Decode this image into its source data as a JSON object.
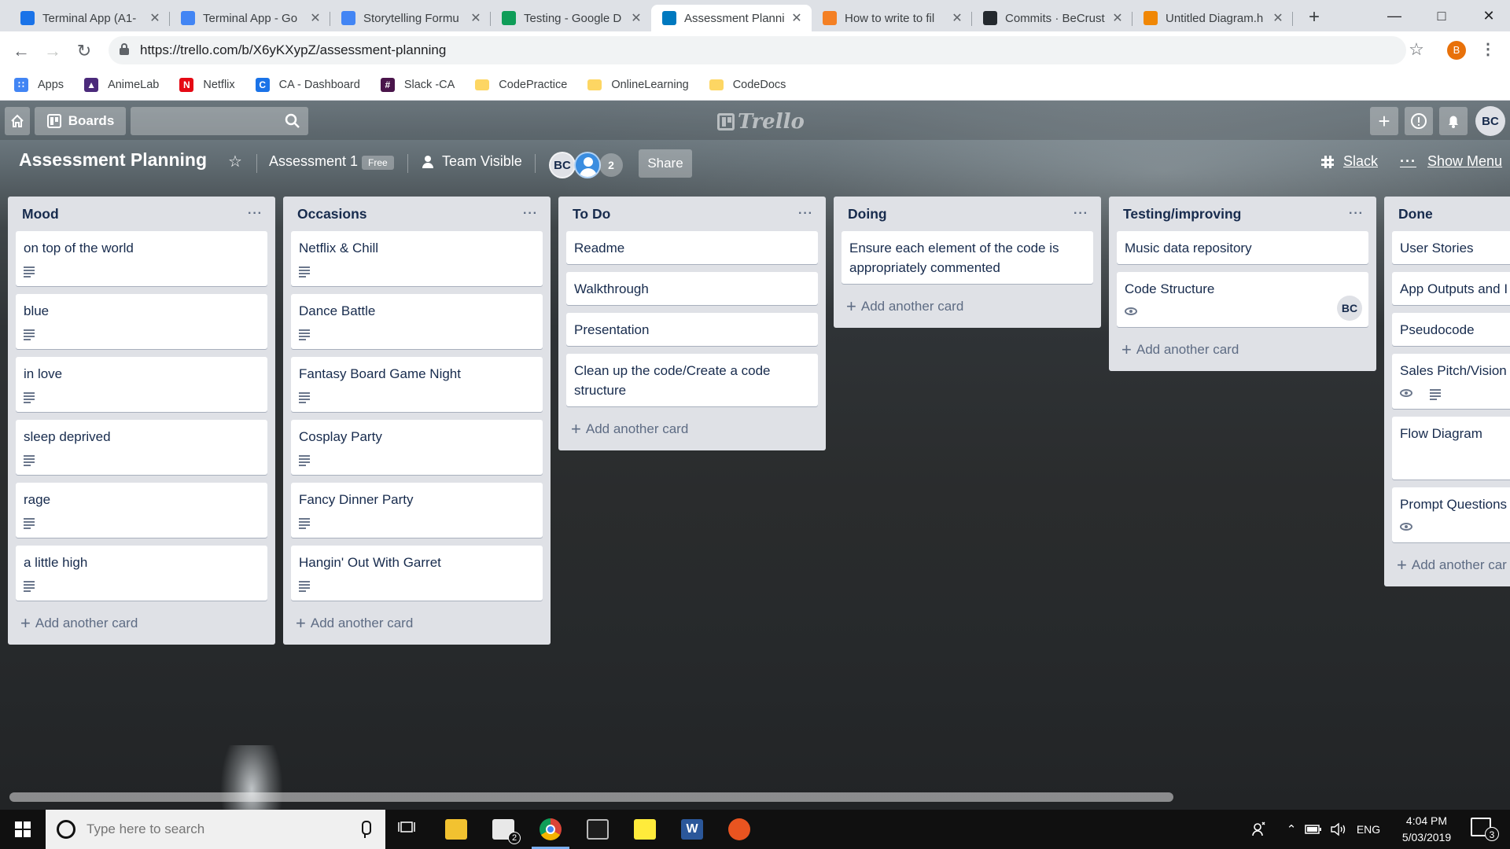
{
  "browser": {
    "tabs": [
      {
        "label": "Terminal App (A1-",
        "favicon": "ca-favicon",
        "color": "#1a73e8"
      },
      {
        "label": "Terminal App - Go",
        "favicon": "google-docs-favicon",
        "color": "#4285f4"
      },
      {
        "label": "Storytelling Formu",
        "favicon": "google-docs-favicon",
        "color": "#4285f4"
      },
      {
        "label": "Testing - Google D",
        "favicon": "google-drive-favicon",
        "color": "#0f9d58"
      },
      {
        "label": "Assessment Planni",
        "favicon": "trello-favicon",
        "color": "#0079bf"
      },
      {
        "label": "How to write to fil",
        "favicon": "stack-favicon",
        "color": "#f48024"
      },
      {
        "label": "Commits · BeCrust",
        "favicon": "github-favicon",
        "color": "#24292e"
      },
      {
        "label": "Untitled Diagram.h",
        "favicon": "drawio-favicon",
        "color": "#f08705"
      }
    ],
    "active_tab": 4,
    "url": "https://trello.com/b/X6yKXypZ/assessment-planning",
    "profile_initial": "B",
    "bookmarks": [
      {
        "label": "Apps",
        "icon": "apps-grid-icon"
      },
      {
        "label": "AnimeLab",
        "icon": "animelab-icon"
      },
      {
        "label": "Netflix",
        "icon": "netflix-icon"
      },
      {
        "label": "CA - Dashboard",
        "icon": "ca-icon"
      },
      {
        "label": "Slack -CA",
        "icon": "slack-icon"
      },
      {
        "label": "CodePractice",
        "icon": "folder-icon"
      },
      {
        "label": "OnlineLearning",
        "icon": "folder-icon"
      },
      {
        "label": "CodeDocs",
        "icon": "folder-icon"
      }
    ]
  },
  "trello": {
    "header": {
      "boards_label": "Boards",
      "search_value": "",
      "logo_text": "Trello",
      "user_initials": "BC"
    },
    "board": {
      "title": "Assessment Planning",
      "team_name": "Assessment 1",
      "team_badge": "Free",
      "visibility": "Team Visible",
      "member_initials": "BC",
      "member_count": "2",
      "share_label": "Share",
      "slack_label": "Slack",
      "show_menu_label": "Show Menu"
    },
    "add_card_label": "Add another card",
    "lists": [
      {
        "title": "Mood",
        "cards": [
          {
            "title": "on top of the world",
            "badges": [
              "description"
            ]
          },
          {
            "title": "blue",
            "badges": [
              "description"
            ]
          },
          {
            "title": "in love",
            "badges": [
              "description"
            ]
          },
          {
            "title": "sleep deprived",
            "badges": [
              "description"
            ]
          },
          {
            "title": "rage",
            "badges": [
              "description"
            ]
          },
          {
            "title": "a little high",
            "badges": [
              "description"
            ]
          }
        ]
      },
      {
        "title": "Occasions",
        "cards": [
          {
            "title": "Netflix & Chill",
            "badges": [
              "description"
            ]
          },
          {
            "title": "Dance Battle",
            "badges": [
              "description"
            ]
          },
          {
            "title": "Fantasy Board Game Night",
            "badges": [
              "description"
            ]
          },
          {
            "title": "Cosplay Party",
            "badges": [
              "description"
            ]
          },
          {
            "title": "Fancy Dinner Party",
            "badges": [
              "description"
            ]
          },
          {
            "title": "Hangin' Out With Garret",
            "badges": [
              "description"
            ]
          }
        ]
      },
      {
        "title": "To Do",
        "cards": [
          {
            "title": "Readme",
            "badges": []
          },
          {
            "title": "Walkthrough",
            "badges": []
          },
          {
            "title": "Presentation",
            "badges": []
          },
          {
            "title": "Clean up the code/Create a code structure",
            "badges": []
          }
        ]
      },
      {
        "title": "Doing",
        "cards": [
          {
            "title": "Ensure each element of the code is appropriately commented",
            "badges": []
          }
        ]
      },
      {
        "title": "Testing/improving",
        "cards": [
          {
            "title": "Music data repository",
            "badges": []
          },
          {
            "title": "Code Structure",
            "badges": [
              "watch"
            ],
            "member": "BC"
          }
        ]
      },
      {
        "title": "Done",
        "cards": [
          {
            "title": "User Stories",
            "badges": []
          },
          {
            "title": "App Outputs and I",
            "badges": []
          },
          {
            "title": "Pseudocode",
            "badges": []
          },
          {
            "title": "Sales Pitch/Vision",
            "badges": [
              "watch",
              "description"
            ]
          },
          {
            "title": "Flow Diagram",
            "badges": [],
            "tall": true
          },
          {
            "title": "Prompt Questions",
            "badges": [
              "watch"
            ]
          }
        ],
        "add_label": "Add another car"
      }
    ]
  },
  "taskbar": {
    "search_placeholder": "Type here to search",
    "apps": [
      "task-view-icon",
      "file-explorer-icon",
      "mail-icon",
      "chrome-icon",
      "terminal-icon",
      "sticky-notes-icon",
      "word-icon",
      "ubuntu-icon"
    ],
    "mail_badge": "2",
    "language": "ENG",
    "time": "4:04 PM",
    "date": "5/03/2019",
    "notification_count": "3"
  }
}
